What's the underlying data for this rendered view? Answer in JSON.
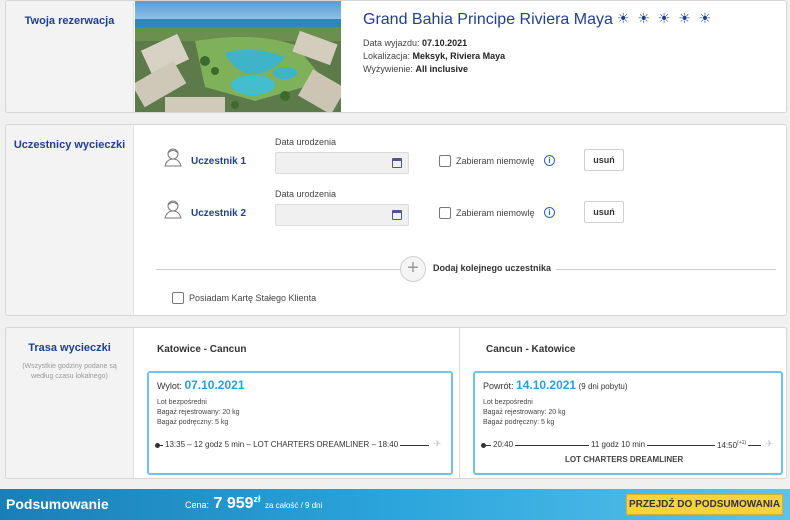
{
  "reservation": {
    "section_title": "Twoja rezerwacja",
    "hotel_name": "Grand Bahia Principe Riviera Maya",
    "stars": "☀ ☀ ☀ ☀ ☀",
    "departure_label": "Data wyjazdu:",
    "departure_value": "07.10.2021",
    "location_label": "Lokalizacja:",
    "location_value": "Meksyk, Riviera Maya",
    "board_label": "Wyżywienie:",
    "board_value": "All inclusive"
  },
  "participants": {
    "section_title": "Uczestnicy wycieczki",
    "items": [
      {
        "name": "Uczestnik 1",
        "dob_label": "Data urodzenia",
        "infant_label": "Zabieram niemowlę",
        "remove_label": "usuń"
      },
      {
        "name": "Uczestnik 2",
        "dob_label": "Data urodzenia",
        "infant_label": "Zabieram niemowlę",
        "remove_label": "usuń"
      }
    ],
    "add_label": "Dodaj kolejnego uczestnika",
    "loyalty_label": "Posiadam Kartę Stałego Klienta"
  },
  "route": {
    "section_title": "Trasa wycieczki",
    "section_note": "(Wszystkie godziny podane są według czasu lokalnego)",
    "outbound": {
      "title": "Katowice - Cancun",
      "head_label": "Wylot:",
      "date": "07.10.2021",
      "flight_type": "Lot bezpośredni",
      "checked_bag": "Bagaż rejestrowany: 20 kg",
      "hand_bag": "Bagaż podręczny: 5 kg",
      "timeline": "13:35  –  12 godz 5 min  –  LOT CHARTERS DREAMLINER  –  18:40"
    },
    "return": {
      "title": "Cancun - Katowice",
      "head_label": "Powrót:",
      "date": "14.10.2021",
      "extra": "(9 dni pobytu)",
      "flight_type": "Lot bezpośredni",
      "checked_bag": "Bagaż rejestrowany: 20 kg",
      "hand_bag": "Bagaż podręczny: 5 kg",
      "dep_time": "20:40",
      "duration": "11 godz 10 min",
      "arr_time": "14:50",
      "arr_offset": "(+1)",
      "carrier": "LOT CHARTERS DREAMLINER"
    }
  },
  "summary": {
    "title": "Podsumowanie",
    "price_label": "Cena:",
    "price_value": "7 959",
    "currency": "zł",
    "price_note": "za całość / 9 dni",
    "cta_label": "PRZEJDŹ DO PODSUMOWANIA"
  },
  "colors": {
    "accent": "#1f3f8f",
    "date_blue": "#2a9fd6",
    "cta_yellow": "#f5d33a"
  }
}
